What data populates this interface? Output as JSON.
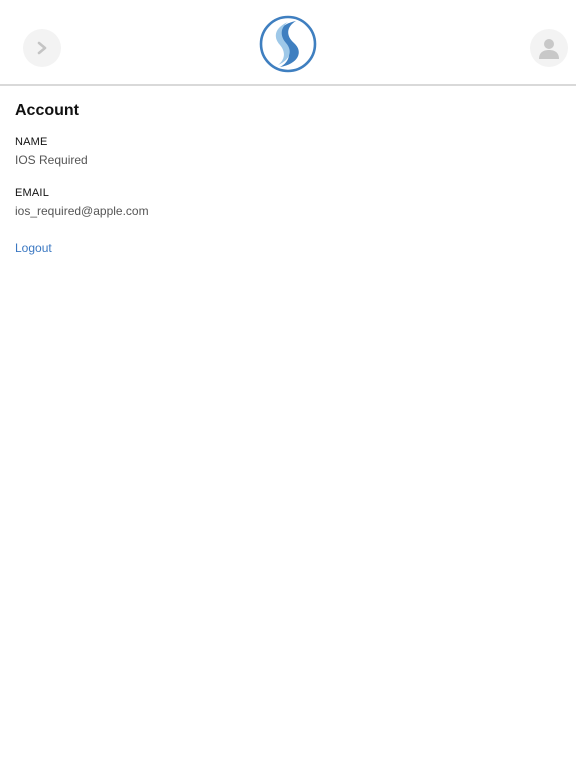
{
  "header": {
    "back_icon": "chevron-right-icon",
    "logo_icon": "brand-s-logo-icon",
    "profile_icon": "user-silhouette-icon"
  },
  "account": {
    "title": "Account",
    "name_label": "NAME",
    "name_value": "IOS Required",
    "email_label": "EMAIL",
    "email_value": "ios_required@apple.com",
    "logout_label": "Logout"
  },
  "colors": {
    "link": "#3b78c2",
    "logo_primary": "#3f7fc0",
    "logo_secondary": "#9ec8e8",
    "icon_gray": "#c8c8c8",
    "button_bg": "#f3f3f3",
    "divider": "#d9d9d9"
  }
}
